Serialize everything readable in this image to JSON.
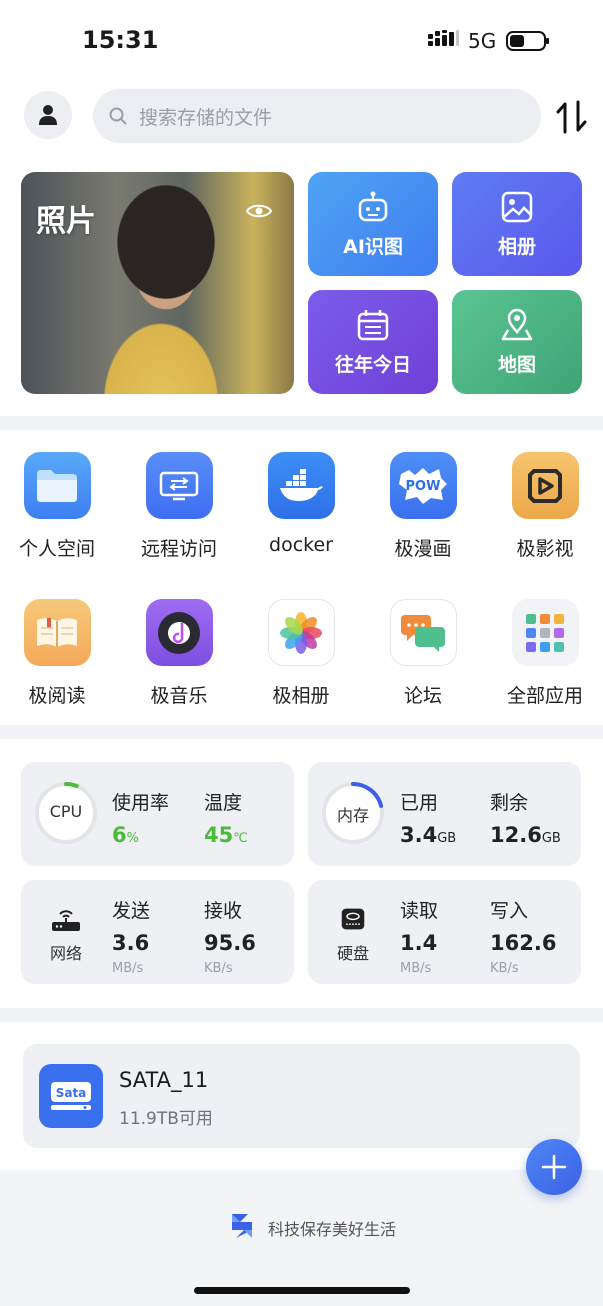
{
  "status": {
    "time": "15:31",
    "network": "5G"
  },
  "search": {
    "placeholder": "搜索存储的文件"
  },
  "photos": {
    "label": "照片",
    "tiles": {
      "ai": "AI识图",
      "album": "相册",
      "today": "往年今日",
      "map": "地图"
    }
  },
  "apps": [
    {
      "label": "个人空间",
      "icon": "folder-icon"
    },
    {
      "label": "远程访问",
      "icon": "remote-access-icon"
    },
    {
      "label": "docker",
      "icon": "docker-icon"
    },
    {
      "label": "极漫画",
      "icon": "comic-icon"
    },
    {
      "label": "极影视",
      "icon": "video-icon"
    },
    {
      "label": "极阅读",
      "icon": "book-icon"
    },
    {
      "label": "极音乐",
      "icon": "music-icon"
    },
    {
      "label": "极相册",
      "icon": "photos-icon"
    },
    {
      "label": "论坛",
      "icon": "forum-icon"
    },
    {
      "label": "全部应用",
      "icon": "all-apps-icon"
    }
  ],
  "stats": {
    "cpu": {
      "name": "CPU",
      "usage_label": "使用率",
      "usage_value": "6",
      "usage_unit": "%",
      "usage_fraction": 0.06,
      "temp_label": "温度",
      "temp_value": "45",
      "temp_unit": "℃"
    },
    "memory": {
      "name": "内存",
      "used_label": "已用",
      "used_value": "3.4",
      "used_unit": "GB",
      "used_fraction": 0.21,
      "free_label": "剩余",
      "free_value": "12.6",
      "free_unit": "GB"
    },
    "network": {
      "name": "网络",
      "send_label": "发送",
      "send_value": "3.6",
      "send_unit": "MB/s",
      "recv_label": "接收",
      "recv_value": "95.6",
      "recv_unit": "KB/s"
    },
    "disk": {
      "name": "硬盘",
      "read_label": "读取",
      "read_value": "1.4",
      "read_unit": "MB/s",
      "write_label": "写入",
      "write_value": "162.6",
      "write_unit": "KB/s"
    }
  },
  "storage": {
    "name": "SATA_11",
    "free": "11.9TB可用",
    "icon_text": "Sata"
  },
  "footer": {
    "slogan": "科技保存美好生活"
  },
  "colors": {
    "accent": "#3b62e6",
    "green": "#4cbb3c",
    "card_bg": "#eef0f3"
  }
}
